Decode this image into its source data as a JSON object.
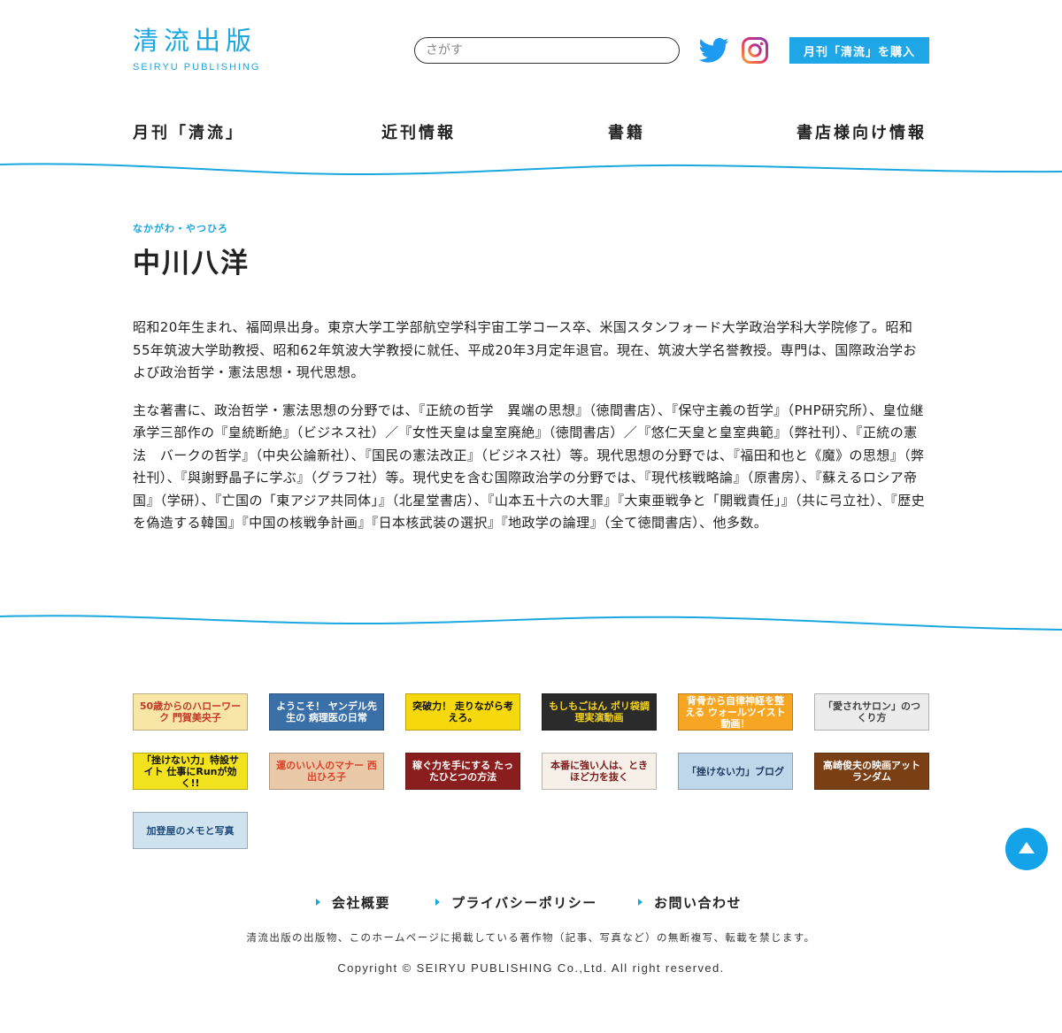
{
  "header": {
    "logo_jp": "清流出版",
    "logo_en": "SEIRYU PUBLISHING",
    "search_placeholder": "さがす",
    "buy_label": "月刊「清流」を購入",
    "twitter_icon": "twitter-bird-icon",
    "instagram_icon": "instagram-icon"
  },
  "nav": {
    "items": [
      "月刊「清流」",
      "近刊情報",
      "書籍",
      "書店様向け情報"
    ]
  },
  "author": {
    "ruby": "なかがわ・やつひろ",
    "name": "中川八洋",
    "bio": [
      "昭和20年生まれ、福岡県出身。東京大学工学部航空学科宇宙工学コース卒、米国スタンフォード大学政治学科大学院修了。昭和55年筑波大学助教授、昭和62年筑波大学教授に就任、平成20年3月定年退官。現在、筑波大学名誉教授。専門は、国際政治学および政治哲学・憲法思想・現代思想。",
      "主な著書に、政治哲学・憲法思想の分野では、『正統の哲学　異端の思想』（徳間書店）、『保守主義の哲学』（PHP研究所）、皇位継承学三部作の『皇統断絶』（ビジネス社）／『女性天皇は皇室廃絶』（徳間書店）／『悠仁天皇と皇室典範』（弊社刊）、『正統の憲法　バークの哲学』（中央公論新社）、『国民の憲法改正』（ビジネス社）等。現代思想の分野では、『福田和也と《魔》の思想』（弊社刊）、『與謝野晶子に学ぶ』（グラフ社）等。現代史を含む国際政治学の分野では、『現代核戦略論』（原書房）、『蘇えるロシア帝国』（学研）、『亡国の「東アジア共同体」』（北星堂書店）、『山本五十六の大罪』『大東亜戦争と「開戦責任」』（共に弓立社）、『歴史を偽造する韓国』『中国の核戦争計画』『日本核武装の選択』『地政学の論理』（全て徳間書店）、他多数。"
    ]
  },
  "banners": [
    {
      "text": "50歳からのハローワーク 門賀美央子",
      "bg": "#f7e6a6",
      "fg": "#c0392b"
    },
    {
      "text": "ようこそ！ ヤンデル先生の 病理医の日常",
      "bg": "#3a6fa8",
      "fg": "#ffffff"
    },
    {
      "text": "突破力！ 走りながら考えろ。",
      "bg": "#f5d90c",
      "fg": "#111111"
    },
    {
      "text": "もしもごはん ポリ袋調理実演動画",
      "bg": "#2b2b2b",
      "fg": "#f5d31b"
    },
    {
      "text": "背骨から自律神経を整える ウォールツイスト動画！",
      "bg": "#f6a623",
      "fg": "#ffffff"
    },
    {
      "text": "「愛されサロン」のつくり方",
      "bg": "#ececec",
      "fg": "#444444"
    },
    {
      "text": "「挫けない力」特設サイト 仕事にRunが効く!!",
      "bg": "#f2e31e",
      "fg": "#111111"
    },
    {
      "text": "運のいい人のマナー 西出ひろ子",
      "bg": "#e9c9a8",
      "fg": "#d8442a"
    },
    {
      "text": "稼ぐ力を手にする たったひとつの方法",
      "bg": "#8a1e1e",
      "fg": "#ffffff"
    },
    {
      "text": "本番に強い人は、ときほど力を抜く",
      "bg": "#f7f0e8",
      "fg": "#7a1c1c"
    },
    {
      "text": "「挫けない力」ブログ",
      "bg": "#bfd7ea",
      "fg": "#1e3a5f"
    },
    {
      "text": "高崎俊夫の映画アットランダム",
      "bg": "#7a3f14",
      "fg": "#ffffff"
    },
    {
      "text": "加登屋のメモと写真",
      "bg": "#cfe3ef",
      "fg": "#1e4a7a"
    }
  ],
  "footer": {
    "links": [
      "会社概要",
      "プライバシーポリシー",
      "お問い合わせ"
    ],
    "notice": "清流出版の出版物、このホームページに掲載している著作物（記事、写真など）の無断複写、転載を禁じます。",
    "copyright": "Copyright © SEIRYU PUBLISHING Co.,Ltd. All right reserved."
  }
}
